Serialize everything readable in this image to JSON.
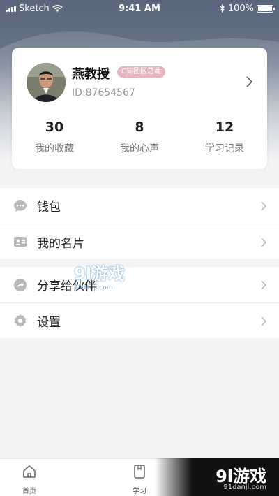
{
  "status_bar": {
    "carrier": "Sketch",
    "time": "9:41 AM",
    "battery": "100%"
  },
  "profile": {
    "name": "燕教授",
    "badge": "C集团区总裁",
    "id_text": "ID:87654567",
    "stats": [
      {
        "value": "30",
        "label": "我的收藏"
      },
      {
        "value": "8",
        "label": "我的心声"
      },
      {
        "value": "12",
        "label": "学习记录"
      }
    ]
  },
  "menu": {
    "group1": [
      {
        "label": "钱包",
        "icon": "chat-bubble-icon"
      },
      {
        "label": "我的名片",
        "icon": "id-card-icon"
      }
    ],
    "group2": [
      {
        "label": "分享给伙伴",
        "icon": "share-icon"
      },
      {
        "label": "设置",
        "icon": "gear-icon"
      }
    ]
  },
  "tabs": [
    {
      "label": "首页",
      "icon": "home-icon"
    },
    {
      "label": "学习",
      "icon": "study-icon"
    }
  ],
  "watermark": {
    "main": "9l游戏",
    "site": "91danji.com"
  },
  "colors": {
    "header_top": "#5f6b80",
    "badge_bg": "#e9b3c2",
    "page_bg": "#f4f4f5"
  }
}
